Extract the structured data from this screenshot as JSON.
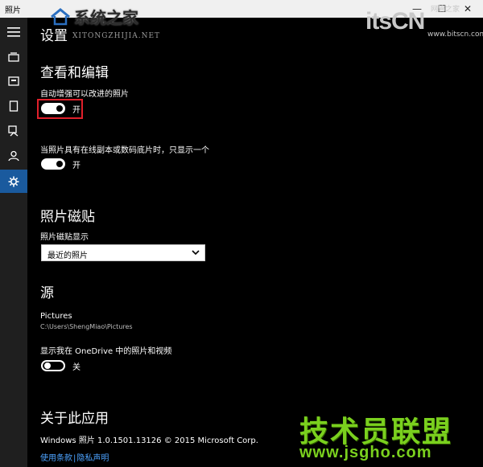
{
  "window": {
    "title": "照片",
    "minimize": "—",
    "maximize": "☐",
    "close": "✕"
  },
  "watermarks": {
    "logo_text": "系统之家",
    "logo_sub": "XITONGZHIJIA.NET",
    "itscn": "itsCN",
    "itscn_sub": "网管之家",
    "itscn_url": "www.bitscn.com",
    "bottom_cn": "技术员联盟",
    "bottom_url": "www.jsgho.com"
  },
  "sidebar": {
    "items": [
      {
        "icon": "hamburger-menu-icon"
      },
      {
        "icon": "collection-icon"
      },
      {
        "icon": "albums-icon"
      },
      {
        "icon": "folders-icon"
      },
      {
        "icon": "story-remix-icon"
      },
      {
        "icon": "people-icon"
      },
      {
        "icon": "settings-gear-icon",
        "active": true
      }
    ]
  },
  "page": {
    "title": "设置",
    "view_edit": {
      "heading": "查看和编辑",
      "auto_enhance_label": "自动增强可以改进的照片",
      "auto_enhance_state": "开",
      "duplicates_label": "当照片具有在线副本或数码底片时，只显示一个",
      "duplicates_state": "开"
    },
    "live_tile": {
      "heading": "照片磁贴",
      "label": "照片磁贴显示",
      "selected": "最近的照片"
    },
    "sources": {
      "heading": "源",
      "folder_name": "Pictures",
      "folder_path": "C:\\Users\\ShengMiao\\Pictures",
      "onedrive_label": "显示我在 OneDrive 中的照片和视频",
      "onedrive_state": "关"
    },
    "about": {
      "heading": "关于此应用",
      "version": "Windows 照片 1.0.1501.13126 © 2015 Microsoft Corp.",
      "terms": "使用条款",
      "separator": "|",
      "privacy": "隐私声明"
    }
  },
  "colors": {
    "accent": "#1a5a9e",
    "highlight_box": "#e0202b",
    "link": "#4da3ff"
  }
}
